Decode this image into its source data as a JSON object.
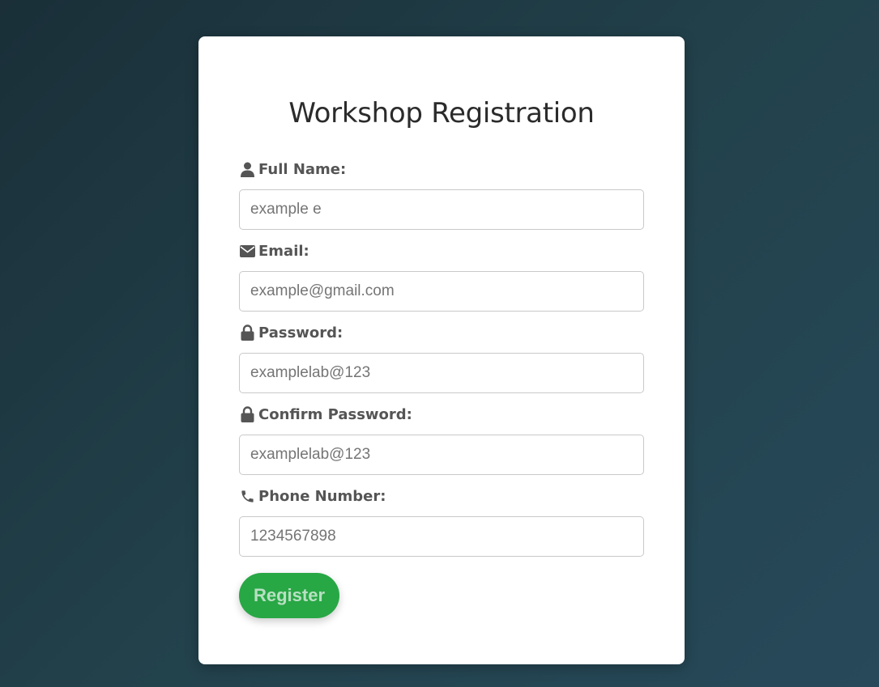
{
  "form": {
    "title": "Workshop Registration",
    "fields": [
      {
        "label": "Full Name:",
        "placeholder": "example e",
        "value": "",
        "icon": "user-icon"
      },
      {
        "label": "Email:",
        "placeholder": "example@gmail.com",
        "value": "",
        "icon": "envelope-icon"
      },
      {
        "label": "Password:",
        "placeholder": "examplelab@123",
        "value": "",
        "icon": "lock-icon"
      },
      {
        "label": "Confirm Password:",
        "placeholder": "examplelab@123",
        "value": "",
        "icon": "lock-icon"
      },
      {
        "label": "Phone Number:",
        "placeholder": "1234567898",
        "value": "",
        "icon": "phone-icon"
      }
    ],
    "submit_label": "Register"
  },
  "colors": {
    "accent": "#28a745",
    "label_text": "#555555",
    "title_text": "#2b2b2b",
    "background_start": "#1a2f38",
    "background_end": "#27495a"
  }
}
